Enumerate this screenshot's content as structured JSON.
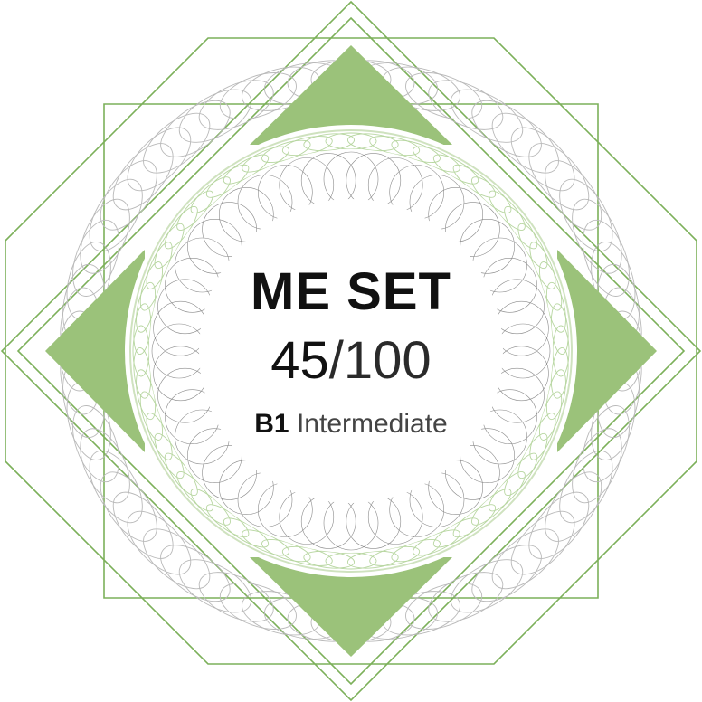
{
  "badge": {
    "title": "ME SET",
    "score": "45",
    "separator": "/",
    "max_score": "100",
    "level_code": "B1",
    "level_name": "Intermediate"
  },
  "colors": {
    "accent_green": "#9bc27a",
    "line_green": "#7cb05a",
    "guilloche_gray": "#b9b9b9",
    "guilloche_dark": "#8a8a8a",
    "guilloche_green": "#b7d6a0",
    "text": "#111111"
  },
  "decor": {
    "style": "guilloche-seal"
  }
}
